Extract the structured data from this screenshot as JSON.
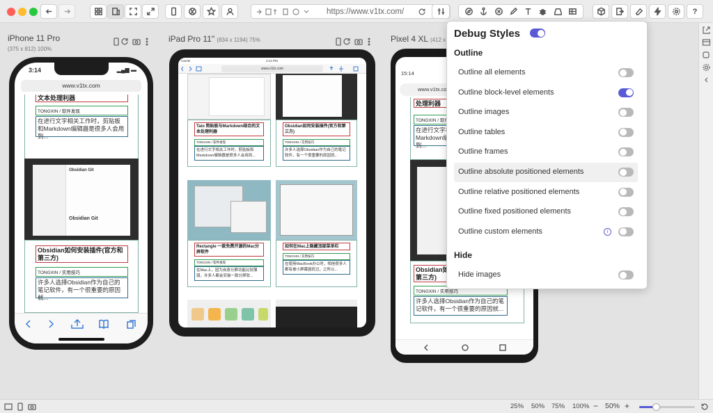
{
  "toolbar": {
    "url": "https://www.v1tx.com/"
  },
  "devices": [
    {
      "name": "iPhone 11 Pro",
      "dims": "(375 x 812) 100%"
    },
    {
      "name": "iPad Pro 11\"",
      "dims": "(834 x 1194) 75%"
    },
    {
      "name": "Pixel 4 XL",
      "dims": "(412 x"
    }
  ],
  "iphone": {
    "time": "3:14",
    "url": "www.v1tx.com",
    "top_title": "文本处理利器",
    "tag1": "TONGXIN  /  软件发现",
    "text1": "在进行文字相关工作时，剪贴板和Markdown编辑器是很多人会用到...",
    "thumb_label1": "Obsidian Git",
    "thumb_label2": "Obsidian Git",
    "title2": "Obsidian如何安装插件(官方和第三方)",
    "tag2": "TONGXIN  /  实用技巧",
    "text2": "许多人选择Obsidian作为自己的笔记软件，有一个很重要的原因就..."
  },
  "ipad": {
    "carrier": "Carrier",
    "time": "3:14 PM",
    "url": "www.v1tx.com",
    "c1_title": "Taio 剪贴板与Markdown结合的文本处理利器",
    "c1_tag": "TONGXIN  /  软件发现",
    "c1_text": "在进行文字相关工作时，剪贴板和Markdown编辑器是很多人会用到...",
    "c2_title": "Obsidian如何安装插件(官方和第三方)",
    "c2_tag": "TONGXIN  /  实用技巧",
    "c2_text": "许多人选择Obsidian作为自己的笔记软件，有一个很重要的原因就...",
    "c3_title": "Rectangle 一款免费开源的Mac分屏软件",
    "c3_tag": "TONGXIN  /  软件发现",
    "c3_text": "在Mac上，因为自身分屏功能比较薄弱，许多人都会安装一款分屏软...",
    "c4_title": "如何在Mac上隐藏顶部菜单栏",
    "c4_tag": "TONGXIN  /  实用技巧",
    "c4_text": "在使用MacBook办公时，相信很多人都有被小屏幕困扰过，之所以..."
  },
  "pixel": {
    "time": "15:14",
    "url": "www.v1tx.com",
    "top_title": "处理利器",
    "tag1": "TONGXIN  /  软件发现",
    "text1": "在进行文字相关工作时，剪贴板和Markdown编辑器是很多人会用到...",
    "title2": "Obsidian如何安装插件(官方和第三方)",
    "tag2": "TONGXIN  /  实用技巧",
    "text2": "许多人选择Obsidian作为自己的笔记软件，有一个很重要的原因就..."
  },
  "panel": {
    "title": "Debug Styles",
    "section_outline": "Outline",
    "section_hide": "Hide",
    "options": [
      {
        "label": "Outline all elements",
        "on": false
      },
      {
        "label": "Outline block-level elements",
        "on": true
      },
      {
        "label": "Outline images",
        "on": false
      },
      {
        "label": "Outline tables",
        "on": false
      },
      {
        "label": "Outline frames",
        "on": false
      },
      {
        "label": "Outline absolute positioned elements",
        "on": false
      },
      {
        "label": "Outline relative positioned elements",
        "on": false
      },
      {
        "label": "Outline fixed positioned elements",
        "on": false
      },
      {
        "label": "Outline custom elements",
        "on": false
      }
    ],
    "hide_options": [
      {
        "label": "Hide images",
        "on": false
      }
    ],
    "accent": "#5a5ad6"
  },
  "status": {
    "zoom_presets": [
      "25%",
      "50%",
      "75%",
      "100%"
    ],
    "zoom_current": "50%",
    "minus": "−",
    "plus": "+",
    "slider_level": 0.3
  }
}
